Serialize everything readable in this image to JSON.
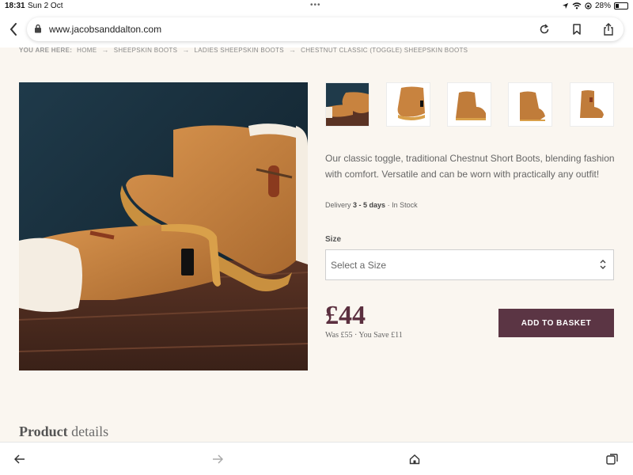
{
  "status": {
    "time": "18:31",
    "date": "Sun 2 Oct",
    "battery": "28%",
    "battery_level": 0.28
  },
  "browser": {
    "url": "www.jacobsanddalton.com"
  },
  "breadcrumb": {
    "label": "YOU ARE HERE:",
    "items": [
      "HOME",
      "SHEEPSKIN BOOTS",
      "LADIES SHEEPSKIN BOOTS",
      "CHESTNUT CLASSIC (TOGGLE) SHEEPSKIN BOOTS"
    ]
  },
  "product": {
    "description": "Our classic toggle, traditional Chestnut Short Boots, blending fashion with comfort. Versatile and can be worn with practically any outfit!",
    "delivery_label": "Delivery",
    "delivery_time": "3 - 5 days",
    "stock": "In Stock",
    "size_label": "Size",
    "size_placeholder": "Select a Size",
    "price": "£44",
    "was_text": "Was £55 · You Save £11",
    "add_button": "ADD TO BASKET"
  },
  "details_heading": {
    "bold": "Product",
    "rest": "details"
  },
  "colors": {
    "accent": "#5b3544",
    "price": "#5b2f3f",
    "background": "#faf6f0"
  },
  "icons": [
    "lock-icon",
    "reload-icon",
    "bookmark-icon",
    "share-icon",
    "back-icon",
    "forward-icon",
    "home-icon",
    "tabs-icon",
    "chevron-updown-icon"
  ]
}
